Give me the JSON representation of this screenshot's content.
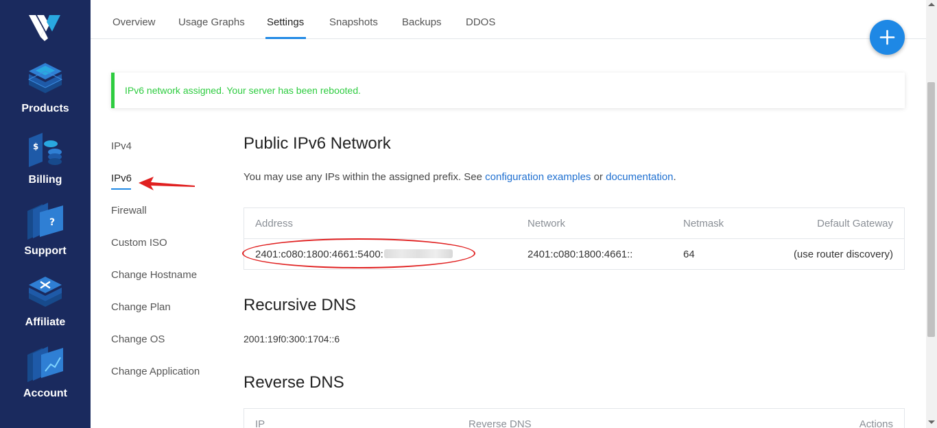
{
  "sidebar": {
    "items": [
      {
        "label": "Products",
        "icon": "products-icon"
      },
      {
        "label": "Billing",
        "icon": "billing-icon"
      },
      {
        "label": "Support",
        "icon": "support-icon"
      },
      {
        "label": "Affiliate",
        "icon": "affiliate-icon"
      },
      {
        "label": "Account",
        "icon": "account-icon"
      }
    ],
    "colors": {
      "background": "#1a2a5e",
      "icon_accent": "#29a8e0"
    }
  },
  "tabs": [
    "Overview",
    "Usage Graphs",
    "Settings",
    "Snapshots",
    "Backups",
    "DDOS"
  ],
  "active_tab": "Settings",
  "fab": {
    "icon": "plus-icon",
    "color": "#1e88e5"
  },
  "alert": {
    "message": "IPv6 network assigned. Your server has been rebooted.",
    "color": "#2ecc40"
  },
  "subnav": [
    "IPv4",
    "IPv6",
    "Firewall",
    "Custom ISO",
    "Change Hostname",
    "Change Plan",
    "Change OS",
    "Change Application"
  ],
  "active_subnav": "IPv6",
  "ipv6": {
    "title": "Public IPv6 Network",
    "desc_prefix": "You may use any IPs within the assigned prefix. See ",
    "link1": "configuration examples",
    "desc_mid": " or ",
    "link2": "documentation",
    "desc_suffix": ".",
    "headers": [
      "Address",
      "Network",
      "Netmask",
      "Default Gateway"
    ],
    "row": {
      "address": "2401:c080:1800:4661:5400:",
      "network": "2401:c080:1800:4661::",
      "netmask": "64",
      "gateway": "(use router discovery)"
    }
  },
  "recursive_dns": {
    "title": "Recursive DNS",
    "value": "2001:19f0:300:1704::6"
  },
  "reverse_dns": {
    "title": "Reverse DNS",
    "headers": [
      "IP",
      "Reverse DNS",
      "Actions"
    ]
  }
}
